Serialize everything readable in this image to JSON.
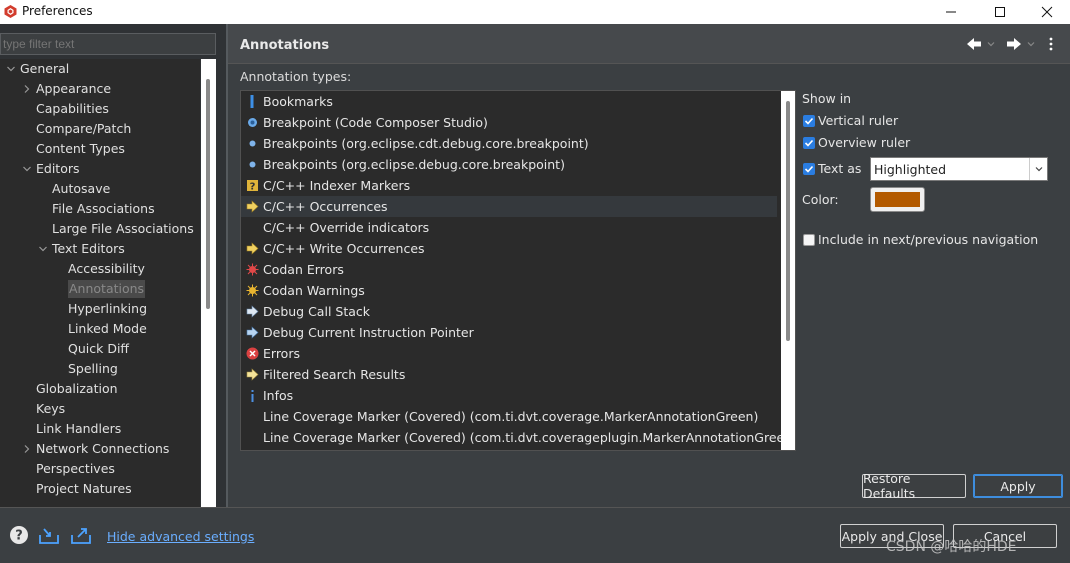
{
  "window": {
    "title": "Preferences",
    "minimize_glyph": "—",
    "maximize_glyph": "☐",
    "close_glyph": "✕"
  },
  "filter": {
    "placeholder": "type filter text",
    "value": ""
  },
  "tree": {
    "items": [
      {
        "label": "General",
        "level": 0,
        "twisty": "expanded"
      },
      {
        "label": "Appearance",
        "level": 1,
        "twisty": "collapsed"
      },
      {
        "label": "Capabilities",
        "level": 1,
        "twisty": "none"
      },
      {
        "label": "Compare/Patch",
        "level": 1,
        "twisty": "none"
      },
      {
        "label": "Content Types",
        "level": 1,
        "twisty": "none"
      },
      {
        "label": "Editors",
        "level": 1,
        "twisty": "expanded"
      },
      {
        "label": "Autosave",
        "level": 2,
        "twisty": "none"
      },
      {
        "label": "File Associations",
        "level": 2,
        "twisty": "none"
      },
      {
        "label": "Large File Associations",
        "level": 2,
        "twisty": "none"
      },
      {
        "label": "Text Editors",
        "level": 2,
        "twisty": "expanded"
      },
      {
        "label": "Accessibility",
        "level": 3,
        "twisty": "none"
      },
      {
        "label": "Annotations",
        "level": 3,
        "twisty": "none",
        "selected": true
      },
      {
        "label": "Hyperlinking",
        "level": 3,
        "twisty": "none"
      },
      {
        "label": "Linked Mode",
        "level": 3,
        "twisty": "none"
      },
      {
        "label": "Quick Diff",
        "level": 3,
        "twisty": "none"
      },
      {
        "label": "Spelling",
        "level": 3,
        "twisty": "none"
      },
      {
        "label": "Globalization",
        "level": 1,
        "twisty": "none"
      },
      {
        "label": "Keys",
        "level": 1,
        "twisty": "none"
      },
      {
        "label": "Link Handlers",
        "level": 1,
        "twisty": "none"
      },
      {
        "label": "Network Connections",
        "level": 1,
        "twisty": "collapsed"
      },
      {
        "label": "Perspectives",
        "level": 1,
        "twisty": "none"
      },
      {
        "label": "Project Natures",
        "level": 1,
        "twisty": "none"
      }
    ]
  },
  "page": {
    "title": "Annotations",
    "annotation_types_label": "Annotation types:",
    "annotation_types": [
      {
        "label": "Bookmarks",
        "icon": "bookmark-icon"
      },
      {
        "label": "Breakpoint (Code Composer Studio)",
        "icon": "breakpoint-icon"
      },
      {
        "label": "Breakpoints (org.eclipse.cdt.debug.core.breakpoint)",
        "icon": "breakpoint-dot-icon"
      },
      {
        "label": "Breakpoints (org.eclipse.debug.core.breakpoint)",
        "icon": "breakpoint-dot-icon"
      },
      {
        "label": "C/C++ Indexer Markers",
        "icon": "indexer-marker-icon"
      },
      {
        "label": "C/C++ Occurrences",
        "icon": "occurrence-arrow-icon",
        "selected": true
      },
      {
        "label": "C/C++ Override indicators",
        "icon": "none"
      },
      {
        "label": "C/C++ Write Occurrences",
        "icon": "occurrence-arrow-icon"
      },
      {
        "label": "Codan Errors",
        "icon": "codan-error-icon"
      },
      {
        "label": "Codan Warnings",
        "icon": "codan-warning-icon"
      },
      {
        "label": "Debug Call Stack",
        "icon": "call-stack-arrow-icon"
      },
      {
        "label": "Debug Current Instruction Pointer",
        "icon": "instruction-pointer-icon"
      },
      {
        "label": "Errors",
        "icon": "error-icon"
      },
      {
        "label": "Filtered Search Results",
        "icon": "search-result-arrow-icon"
      },
      {
        "label": "Infos",
        "icon": "info-icon"
      },
      {
        "label": "Line Coverage Marker (Covered) (com.ti.dvt.coverage.MarkerAnnotationGreen)",
        "icon": "none"
      },
      {
        "label": "Line Coverage Marker (Covered) (com.ti.dvt.coverageplugin.MarkerAnnotationGreen)",
        "icon": "none"
      }
    ],
    "show_in_label": "Show in",
    "vertical_ruler": {
      "label": "Vertical ruler",
      "checked": true
    },
    "overview_ruler": {
      "label": "Overview ruler",
      "checked": true
    },
    "text_as": {
      "label": "Text as",
      "checked": true,
      "value": "Highlighted"
    },
    "color_label": "Color:",
    "color_value": "#b35a00",
    "include_nav": {
      "label": "Include in next/previous navigation",
      "checked": false
    },
    "restore_defaults": "Restore Defaults",
    "apply": "Apply"
  },
  "footer": {
    "advanced_link": "Hide advanced settings",
    "apply_and_close": "Apply and Close",
    "cancel": "Cancel",
    "watermark": "CSDN @哈哈的HDE"
  },
  "colors": {
    "accent": "#2a7de1",
    "link": "#6aaeff",
    "background": "#3b3f42"
  }
}
